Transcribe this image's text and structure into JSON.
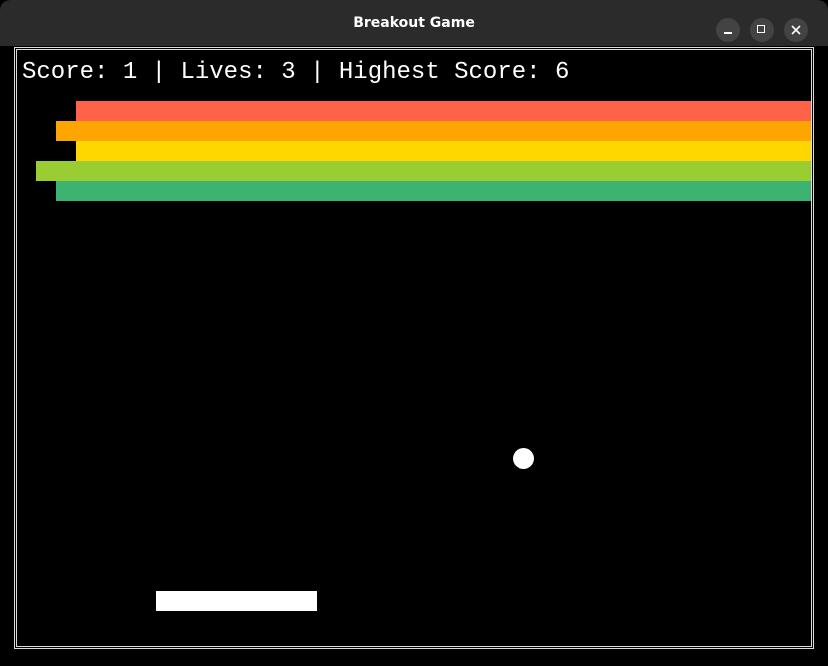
{
  "window": {
    "title": "Breakout Game"
  },
  "hud": {
    "score_label": "Score:",
    "score": "1",
    "lives_label": "Lives:",
    "lives": "3",
    "highest_label": "Highest Score:",
    "highest": "6",
    "separator": "|"
  },
  "bricks": {
    "rows": [
      {
        "color": "#ff6347"
      },
      {
        "color": "#ffa500"
      },
      {
        "color": "#ffd700"
      },
      {
        "color": "#9acd32"
      },
      {
        "color": "#3cb371"
      }
    ]
  },
  "colors": {
    "background": "#000000",
    "paddle": "#ffffff",
    "ball": "#ffffff",
    "titlebar": "#2b2b2b"
  },
  "icons": {
    "minimize": "minimize-icon",
    "maximize": "maximize-icon",
    "close": "close-icon"
  }
}
